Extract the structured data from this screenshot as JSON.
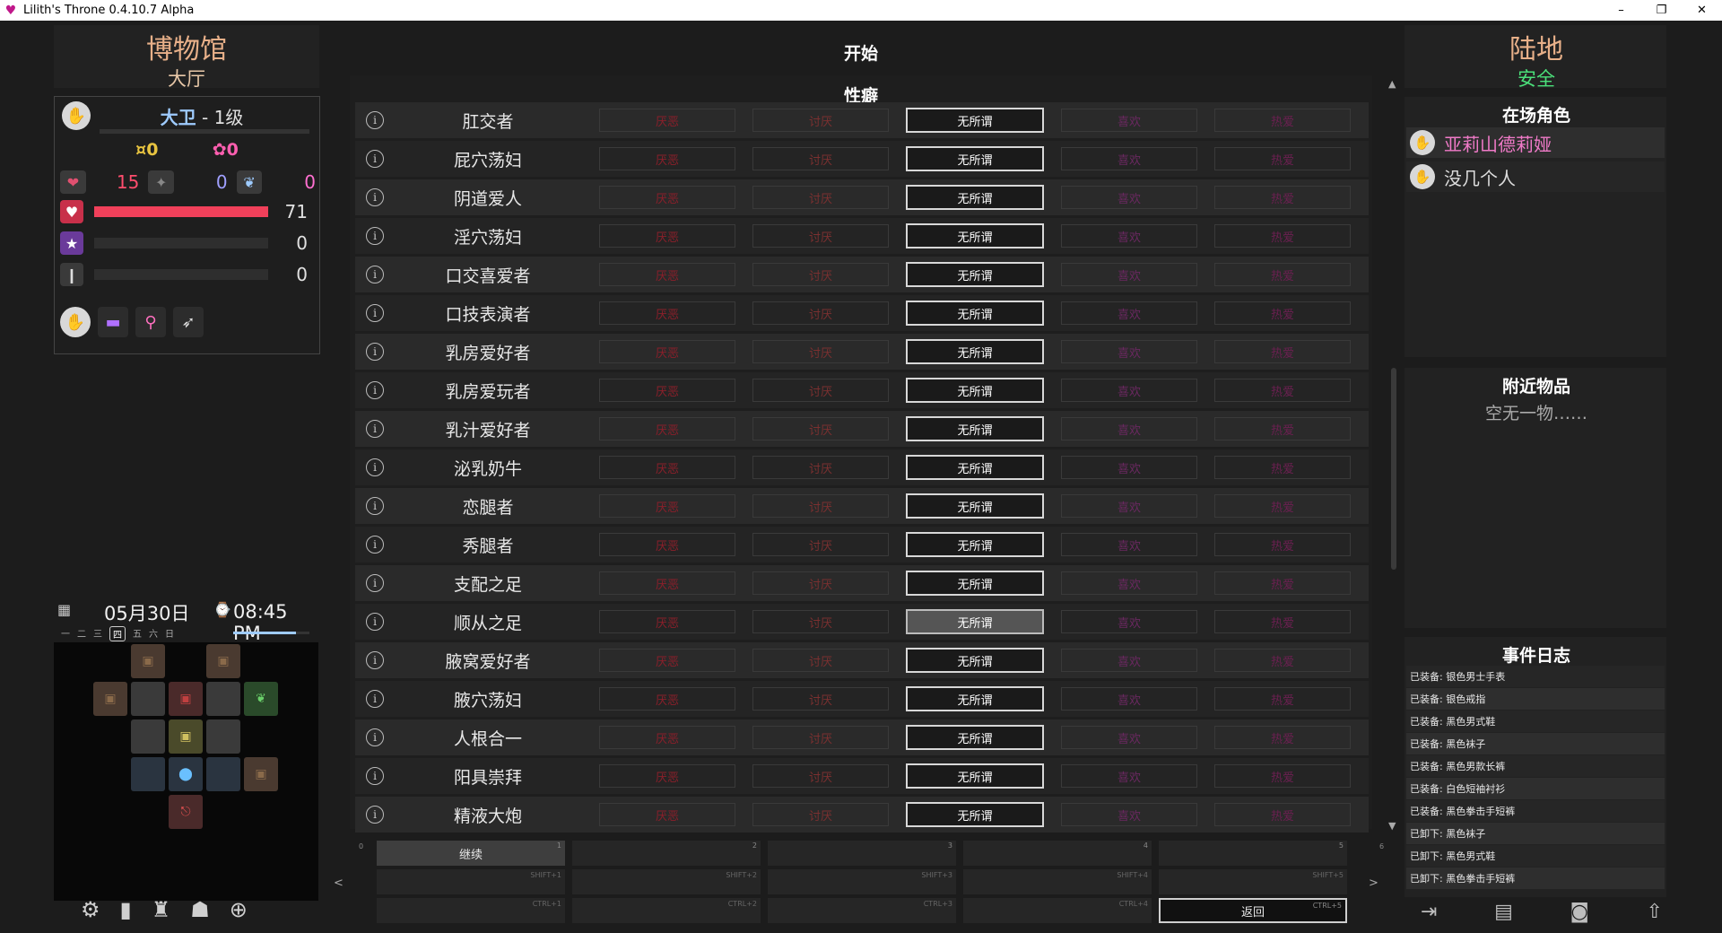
{
  "window": {
    "title": "Lilith's Throne 0.4.10.7 Alpha",
    "min": "–",
    "max": "❐",
    "close": "✕"
  },
  "location": {
    "title": "博物馆",
    "subtitle": "大厅"
  },
  "character": {
    "name": "大卫",
    "level_text": " - 1级",
    "gold": "0",
    "essence": "0",
    "stats": [
      "15",
      "0",
      "0"
    ],
    "health": {
      "value": "71",
      "fraction": 1.0,
      "color": "#f0405a"
    },
    "mana": {
      "value": "0",
      "fraction": 0
    },
    "lust": {
      "value": "0",
      "fraction": 0
    }
  },
  "calendar": {
    "date": "05月30日",
    "time": "08:45 PM",
    "weekdays": [
      "一",
      "二",
      "三",
      "四",
      "五",
      "六",
      "日"
    ],
    "current_day_index": 3
  },
  "center": {
    "title": "开始",
    "section": "性癖",
    "options": [
      "厌恶",
      "讨厌",
      "无所谓",
      "喜欢",
      "热爱"
    ],
    "fetishes": [
      "肛交者",
      "屁穴荡妇",
      "阴道爱人",
      "淫穴荡妇",
      "口交喜爱者",
      "口技表演者",
      "乳房爱好者",
      "乳房爱玩者",
      "乳汁爱好者",
      "泌乳奶牛",
      "恋腿者",
      "秀腿者",
      "支配之足",
      "顺从之足",
      "腋窝爱好者",
      "腋穴荡妇",
      "人根合一",
      "阳具崇拜",
      "精液大炮"
    ],
    "highlighted_index": 13
  },
  "actions": {
    "continue_label": "继续",
    "return_label": "返回",
    "slot_numbers": [
      "0",
      "1",
      "2",
      "3",
      "4",
      "5",
      "6"
    ],
    "shift_keys": [
      "SHIFT+1",
      "SHIFT+2",
      "SHIFT+3",
      "SHIFT+4",
      "SHIFT+5"
    ],
    "ctrl_keys": [
      "CTRL+1",
      "CTRL+2",
      "CTRL+3",
      "CTRL+4",
      "CTRL+5"
    ],
    "prev": "<",
    "next": ">"
  },
  "right": {
    "region_title": "陆地",
    "region_status": "安全",
    "present_heading": "在场角色",
    "present": [
      {
        "name": "亚莉山德莉娅",
        "color": "#f07ac8"
      },
      {
        "name": "没几个人",
        "color": "#dddddd"
      }
    ],
    "nearby_heading": "附近物品",
    "nearby_empty": "空无一物……",
    "log_heading": "事件日志",
    "log": [
      "已装备: 银色男士手表",
      "已装备: 银色戒指",
      "已装备: 黑色男式鞋",
      "已装备: 黑色袜子",
      "已装备: 黑色男款长裤",
      "已装备: 白色短袖衬衫",
      "已装备: 黑色拳击手短裤",
      "已卸下: 黑色袜子",
      "已卸下: 黑色男式鞋",
      "已卸下: 黑色拳击手短裤"
    ]
  }
}
